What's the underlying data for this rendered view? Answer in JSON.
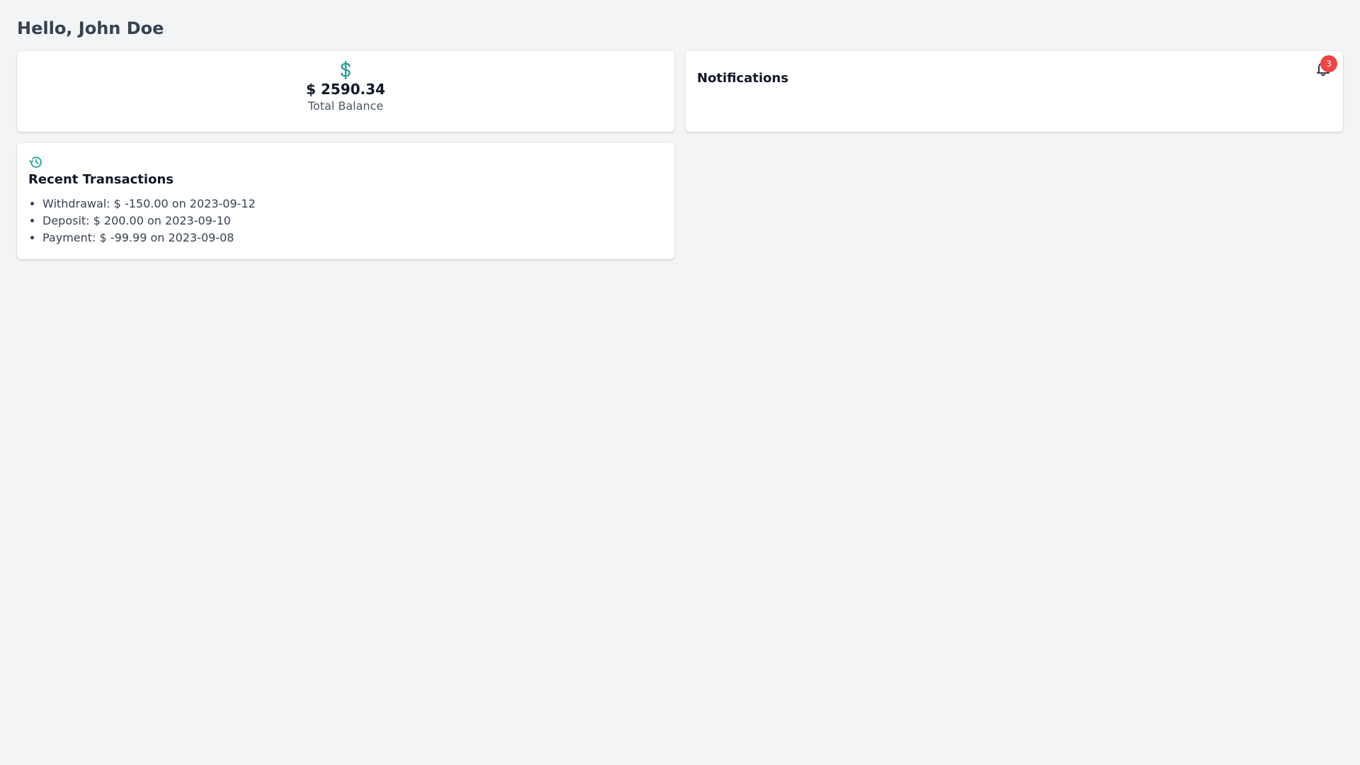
{
  "header": {
    "greeting": "Hello, John Doe"
  },
  "balance": {
    "icon": "dollar-icon",
    "amount": "$ 2590.34",
    "label": "Total Balance",
    "accent_color": "#2aa198"
  },
  "notifications": {
    "title": "Notifications",
    "icon": "bell-icon",
    "badge_count": "3",
    "badge_color": "#ef4444"
  },
  "transactions": {
    "icon": "history-icon",
    "title": "Recent Transactions",
    "items": [
      "Withdrawal: $ -150.00 on 2023-09-12",
      "Deposit: $ 200.00 on 2023-09-10",
      "Payment: $ -99.99 on 2023-09-08"
    ]
  }
}
